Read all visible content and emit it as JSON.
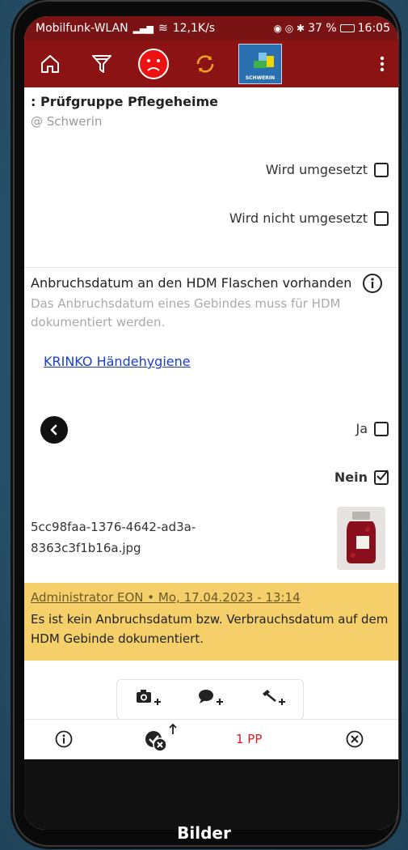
{
  "status": {
    "network": "Mobilfunk-WLAN",
    "speed": "12,1K/s",
    "battery": "37 %",
    "time": "16:05"
  },
  "header": {
    "logo_text": "SCHWERIN"
  },
  "group": {
    "title": ": Prüfgruppe Pflegeheime",
    "location": "@ Schwerin"
  },
  "options_top": [
    {
      "label": "Wird umgesetzt",
      "checked": false
    },
    {
      "label": "Wird nicht umgesetzt",
      "checked": false
    }
  ],
  "question": {
    "title": "Anbruchsdatum an den HDM Flaschen vorhanden",
    "description": "Das Anbruchsdatum eines Gebindes muss für HDM dokumentiert werden.",
    "link": "KRINKO Händehygiene"
  },
  "answers": [
    {
      "label": "Ja",
      "checked": false
    },
    {
      "label": "Nein",
      "checked": true
    }
  ],
  "attachment": {
    "file_name": "5cc98faa-1376-4642-ad3a-8363c3f1b16a.jpg"
  },
  "comment": {
    "author": "Administrator EON • Mo, 17.04.2023 - 13:14",
    "text": "Es ist kein Anbruchsdatum bzw. Verbrauchsdatum auf dem HDM Gebinde dokumentiert."
  },
  "bottom": {
    "count_label": "1 PP",
    "accent": "#d42020"
  },
  "nav": {
    "label": "Bilder"
  },
  "colors": {
    "header": "#8b1313",
    "comment_bg": "#f4cf6a",
    "link": "#1a3fc7"
  }
}
